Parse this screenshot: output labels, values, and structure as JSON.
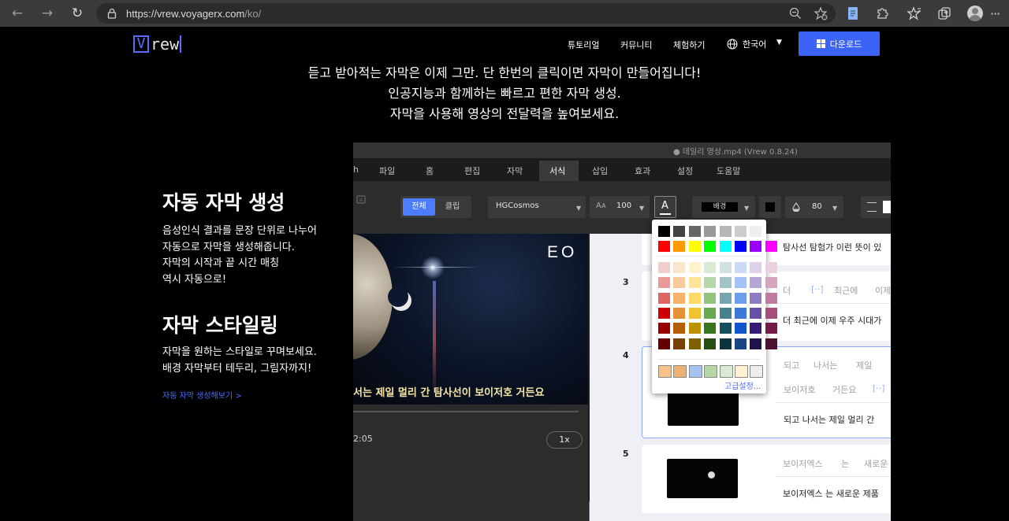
{
  "browser": {
    "url_host": "https://vrew.voyagerx.com",
    "url_path": "/ko/"
  },
  "site": {
    "logo_v": "V",
    "logo_rest": "rew",
    "nav": [
      "튜토리얼",
      "커뮤니티",
      "체험하기"
    ],
    "language": "한국어",
    "download_label": "다운로드"
  },
  "hero": {
    "line1": "듣고 받아적는 자막은 이제 그만. 단 한번의 클릭이면 자막이 만들어집니다!",
    "line2": "인공지능과 함께하는 빠르고 편한 자막 생성.",
    "line3": "자막을 사용해 영상의 전달력을 높여보세요."
  },
  "features": [
    {
      "title": "자동 자막 생성",
      "body": [
        "음성인식 결과를 문장 단위로 나누어",
        "자동으로 자막을 생성해줍니다.",
        "자막의 시작과 끝 시간 매칭",
        "역시 자동으로!"
      ]
    },
    {
      "title": "자막 스타일링",
      "body": [
        "자막을 원하는 스타일로 꾸며보세요.",
        "배경 자막부터 테두리, 그림자까지!"
      ],
      "link": "자동 자막 생성해보기 >"
    }
  ],
  "app": {
    "title": "● 데일리 영상.mp4 (Vrew 0.8.24)",
    "menu": [
      "파일",
      "홈",
      "편집",
      "자막",
      "서식",
      "삽입",
      "효과",
      "설정",
      "도움말"
    ],
    "menu_edge": "h",
    "active_menu": "서식",
    "toolbar": {
      "seg_all": "전체",
      "seg_clip": "클립",
      "font": "HGCosmos",
      "font_size": "100",
      "bg_label": "배경",
      "opacity": "80"
    },
    "video": {
      "watermark": "EO",
      "subtitle": "서는 제일 멀리 간 탐사선이 보이저호 거든요",
      "time": "2:05",
      "speed": "1x"
    },
    "rows": [
      {
        "line": "탐사선 탐험가 이런 뜻이 있"
      },
      {
        "num": "3",
        "tokens": [
          "더",
          "[··]",
          "최근에",
          "이제"
        ],
        "line": "더 최근에 이제 우주 시대가"
      },
      {
        "num": "4",
        "tokens": [
          "되고",
          "나서는",
          "제일",
          "멀"
        ],
        "tokens2": [
          "보이저호",
          "거든요",
          "[··]"
        ],
        "line": "되고 나서는 제일 멀리 간"
      },
      {
        "num": "5",
        "tokens": [
          "보이저엑스",
          "는",
          "새로운"
        ],
        "line": "보이저엑스 는 새로운 제품"
      }
    ],
    "palette": {
      "advanced": "고급설정...",
      "row1": [
        "#000000",
        "#434343",
        "#666666",
        "#999999",
        "#b7b7b7",
        "#cccccc",
        "#efefef"
      ],
      "row2": [
        "#ff0000",
        "#ff9900",
        "#ffff00",
        "#00ff00",
        "#00ffff",
        "#0000ff",
        "#9900ff",
        "#ff00ff"
      ],
      "grid": [
        [
          "#f4cccc",
          "#fce5cd",
          "#fff2cc",
          "#d9ead3",
          "#d0e0e3",
          "#c9daf8",
          "#d9d2e9",
          "#ead1dc"
        ],
        [
          "#ea9999",
          "#f9cb9c",
          "#ffe599",
          "#b6d7a8",
          "#a2c4c9",
          "#a4c2f4",
          "#b4a7d6",
          "#d5a6bd"
        ],
        [
          "#e06666",
          "#f6b26b",
          "#ffd966",
          "#93c47d",
          "#76a5af",
          "#6d9eeb",
          "#8e7cc3",
          "#c27ba0"
        ],
        [
          "#cc0000",
          "#e69138",
          "#f1c232",
          "#6aa84f",
          "#45818e",
          "#3c78d8",
          "#674ea7",
          "#a64d79"
        ],
        [
          "#990000",
          "#b45f06",
          "#bf9000",
          "#38761d",
          "#134f5c",
          "#1155cc",
          "#351c75",
          "#741b47"
        ],
        [
          "#660000",
          "#783f04",
          "#7f6000",
          "#274e13",
          "#0c343d",
          "#1c4587",
          "#20124d",
          "#4c1130"
        ]
      ],
      "recent": [
        "#f6c08f",
        "#f0b070",
        "#a4c2f4",
        "#b6d7a8",
        "#d9ead3",
        "#fff2cc",
        "#eeeeee"
      ]
    }
  }
}
